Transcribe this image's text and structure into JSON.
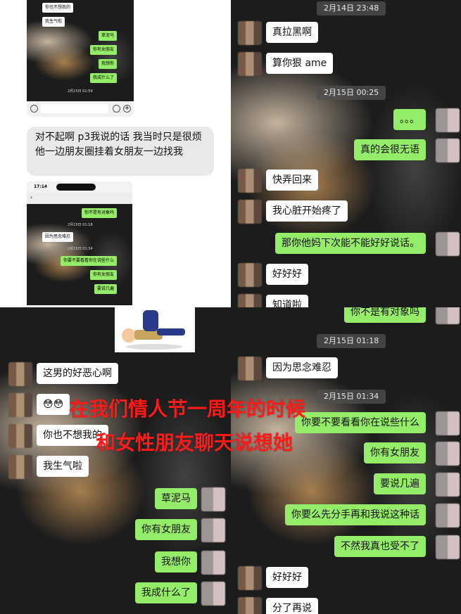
{
  "topleft_phone": {
    "messages": [
      {
        "side": "left",
        "text": "你也不想我的"
      },
      {
        "side": "left",
        "text": "我生气啦"
      },
      {
        "side": "right",
        "text": "草泥马"
      },
      {
        "side": "right",
        "text": "你有女朋友"
      },
      {
        "side": "right",
        "text": "我想你"
      },
      {
        "side": "right",
        "text": "我成什么了"
      }
    ],
    "timestamp": "2月15日 01:59"
  },
  "comment_text": "对不起啊 p3我说的话 我当时只是很烦他一边朋友圈挂着女朋友一边找我",
  "mini_phone": {
    "status_time": "17:14",
    "messages": [
      {
        "side": "right",
        "text": "你不是有对象吗"
      },
      {
        "side": "left",
        "text": "因为思念难忍"
      },
      {
        "side": "right",
        "text": "你要不要看看你在说些什么"
      },
      {
        "side": "right",
        "text": "你有女朋友"
      },
      {
        "side": "right",
        "text": "要说几遍"
      }
    ],
    "timestamps": [
      "2月15日 01:18",
      "2月15日 01:34"
    ]
  },
  "topright": {
    "timestamps": [
      "2月14日 23:48",
      "2月15日 00:25"
    ],
    "messages": [
      {
        "side": "left",
        "text": "真拉黑啊"
      },
      {
        "side": "left",
        "text": "算你狠 ame"
      },
      {
        "side": "right",
        "text": "。。。"
      },
      {
        "side": "right",
        "text": "真的会很无语"
      },
      {
        "side": "left",
        "text": "快弄回来"
      },
      {
        "side": "left",
        "text": "我心脏开始疼了"
      },
      {
        "side": "right",
        "text": "那你他妈下次能不能好好说话。"
      },
      {
        "side": "left",
        "text": "好好好"
      },
      {
        "side": "left",
        "text": "知道啦"
      }
    ]
  },
  "bottomleft": {
    "messages": [
      {
        "side": "left",
        "text": "这男的好恶心啊"
      },
      {
        "side": "left",
        "text": "😳😳"
      },
      {
        "side": "left",
        "text": "你也不想我的"
      },
      {
        "side": "left",
        "text": "我生气啦"
      },
      {
        "side": "right",
        "text": "草泥马"
      },
      {
        "side": "right",
        "text": "你有女朋友"
      },
      {
        "side": "right",
        "text": "我想你"
      },
      {
        "side": "right",
        "text": "我成什么了"
      }
    ]
  },
  "bottomright": {
    "timestamps": [
      "2月15日 01:18",
      "2月15日 01:34"
    ],
    "messages": [
      {
        "side": "right",
        "text": "你不是有对象吗"
      },
      {
        "side": "left",
        "text": "因为思念难忍"
      },
      {
        "side": "right",
        "text": "你要不要看看你在说些什么"
      },
      {
        "side": "right",
        "text": "你有女朋友"
      },
      {
        "side": "right",
        "text": "要说几遍"
      },
      {
        "side": "right",
        "text": "你要么先分手再和我说这种话"
      },
      {
        "side": "right",
        "text": "不然我真也受不了"
      },
      {
        "side": "left",
        "text": "好好好"
      },
      {
        "side": "left",
        "text": "分了再说"
      }
    ]
  },
  "overlay": {
    "line1": "在我们情人节一周年的时候",
    "line2": "和女性朋友聊天说想她",
    "color": "#ff1a1a"
  },
  "colors": {
    "green_bubble": "#95ec69",
    "white_bubble": "#ffffff"
  }
}
